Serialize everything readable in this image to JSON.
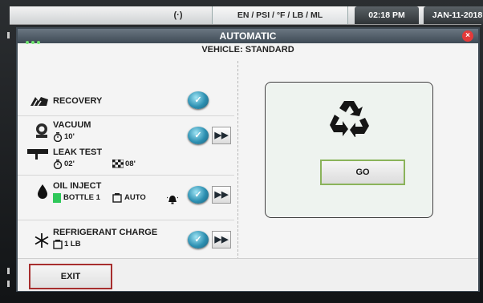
{
  "status_bar": {
    "signal_icon": "radio-signal-icon",
    "signal_glyph": "(·)",
    "units": "EN / PSI / °F / LB / ML",
    "time": "02:18 PM",
    "date": "JAN-11-2018"
  },
  "window": {
    "title": "AUTOMATIC",
    "subtitle": "VEHICLE: STANDARD",
    "close_glyph": "×"
  },
  "steps": [
    {
      "label": "RECOVERY",
      "icon": "recovery-icon"
    },
    {
      "label": "VACUUM",
      "icon": "vacuum-pump-icon",
      "timer": "10'"
    },
    {
      "label": "LEAK TEST",
      "icon": "leak-test-icon",
      "timer": "02'",
      "flag_value": "08'"
    },
    {
      "label": "OIL INJECT",
      "icon": "oil-drop-icon",
      "bottle": "BOTTLE 1",
      "mode": "AUTO"
    },
    {
      "label": "REFRIGERANT CHARGE",
      "icon": "snowflake-icon",
      "amount": "1 LB"
    }
  ],
  "panel": {
    "icon": "recycle-icon",
    "go_label": "GO"
  },
  "exit_label": "EXIT",
  "colors": {
    "accent_blue": "#2c8fb1",
    "go_border": "#8ab35a",
    "exit_border": "#a72e2e",
    "close_red": "#e33a3a",
    "bottle_green": "#2fc85a"
  }
}
